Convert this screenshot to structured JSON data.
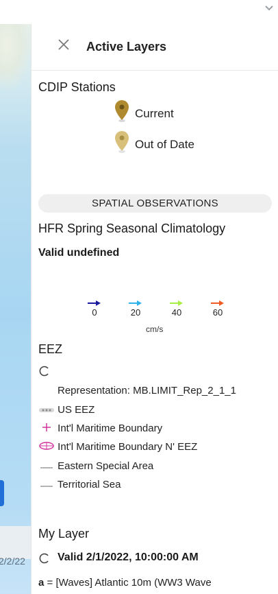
{
  "top_bar": {
    "chevron_icon": "chevron-down-icon"
  },
  "map": {
    "date_text": "2/2/22"
  },
  "panel": {
    "title": "Active Layers",
    "close_icon": "close-icon"
  },
  "cdip": {
    "title": "CDIP Stations",
    "legend": [
      {
        "label": "Current",
        "color": "#b08a2e"
      },
      {
        "label": "Out of Date",
        "color": "#d8c07a"
      }
    ]
  },
  "spatial": {
    "pill_label": "SPATIAL OBSERVATIONS"
  },
  "hfr": {
    "title": "HFR Spring Seasonal Climatology",
    "valid": "Valid undefined",
    "scale": [
      {
        "value": "0",
        "color": "#1a1a9e"
      },
      {
        "value": "20",
        "color": "#2fb2ea"
      },
      {
        "value": "40",
        "color": "#a8ef45"
      },
      {
        "value": "60",
        "color": "#f05a24"
      }
    ],
    "unit": "cm/s"
  },
  "eez": {
    "title": "EEZ",
    "representation": "Representation: MB.LIMIT_Rep_2_1_1",
    "items": [
      {
        "label": "US EEZ",
        "symbol": "us-eez-line-icon"
      },
      {
        "label": "Int'l Maritime Boundary",
        "symbol": "plus-boundary-icon"
      },
      {
        "label": "Int'l Maritime Boundary N' EEZ",
        "symbol": "ellipse-boundary-icon"
      },
      {
        "label": "Eastern Special Area",
        "symbol": "dash-line-icon"
      },
      {
        "label": "Territorial Sea",
        "symbol": "dash-line-icon"
      }
    ]
  },
  "my_layer": {
    "title": "My Layer",
    "valid": "Valid 2/1/2022, 10:00:00 AM",
    "desc_letter": "a",
    "desc_text": " = [Waves] Atlantic 10m (WW3 Wave"
  }
}
